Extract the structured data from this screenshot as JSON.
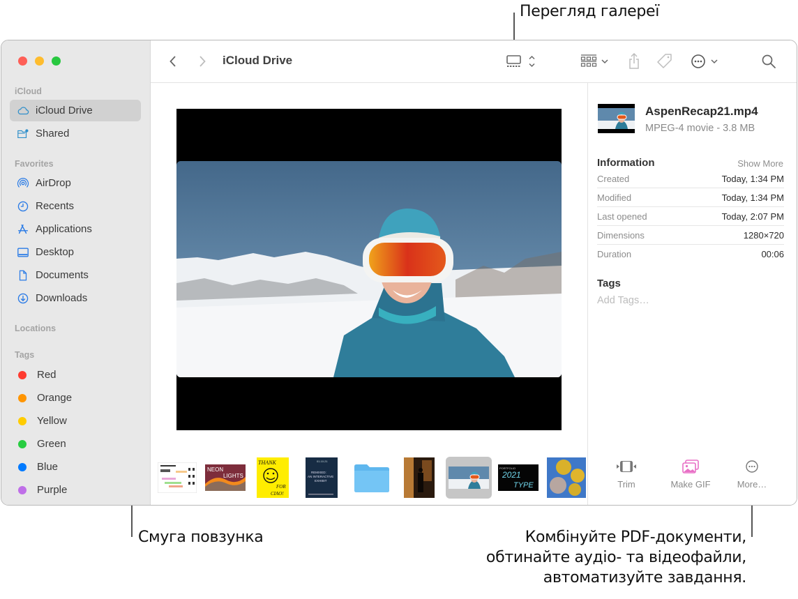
{
  "callouts": {
    "gallery_view": "Перегляд галереї",
    "scrubber_bar": "Смуга повзунка",
    "quick_actions": [
      "Комбінуйте PDF-документи,",
      "обтинайте аудіо- та відеофайли,",
      "автоматизуйте завдання."
    ]
  },
  "window": {
    "toolbar": {
      "title": "iCloud Drive",
      "buttons": [
        "back",
        "forward",
        "gallery-view",
        "group-by",
        "share",
        "tag",
        "more-actions",
        "search"
      ]
    },
    "sidebar": {
      "sections": [
        {
          "label": "iCloud",
          "items": [
            {
              "label": "iCloud Drive",
              "icon": "cloud-icon",
              "selected": true
            },
            {
              "label": "Shared",
              "icon": "shared-folder-icon"
            }
          ]
        },
        {
          "label": "Favorites",
          "items": [
            {
              "label": "AirDrop",
              "icon": "airdrop-icon"
            },
            {
              "label": "Recents",
              "icon": "clock-icon"
            },
            {
              "label": "Applications",
              "icon": "applications-icon"
            },
            {
              "label": "Desktop",
              "icon": "desktop-icon"
            },
            {
              "label": "Documents",
              "icon": "document-icon"
            },
            {
              "label": "Downloads",
              "icon": "download-icon"
            }
          ]
        },
        {
          "label": "Locations",
          "items": []
        },
        {
          "label": "Tags",
          "items": [
            {
              "label": "Red",
              "color": "#fe3b30"
            },
            {
              "label": "Orange",
              "color": "#ff9500"
            },
            {
              "label": "Yellow",
              "color": "#ffcc00"
            },
            {
              "label": "Green",
              "color": "#28cd41"
            },
            {
              "label": "Blue",
              "color": "#007aff"
            },
            {
              "label": "Purple",
              "color": "#bf6fe8"
            }
          ]
        }
      ]
    },
    "scrubber": {
      "thumbnails": [
        {
          "name": "infographic-document"
        },
        {
          "name": "neon-lights-poster",
          "text": "NEON LIGHTS"
        },
        {
          "name": "thank-you-poster",
          "text": "THANK FOR CIAO!"
        },
        {
          "name": "remixed-exhibit-poster",
          "text": "REMIXED: AN INTERACTIVE EXHIBIT"
        },
        {
          "name": "folder"
        },
        {
          "name": "silhouette-photo"
        },
        {
          "name": "aspen-recap-video",
          "selected": true
        },
        {
          "name": "portfolio-2021-type",
          "text": "2021 TYPE"
        },
        {
          "name": "gold-balloons-photo"
        }
      ]
    },
    "inspector": {
      "file_name": "AspenRecap21.mp4",
      "file_kind": "MPEG-4 movie - 3.8 MB",
      "information_label": "Information",
      "show_more": "Show More",
      "rows": [
        {
          "label": "Created",
          "value": "Today, 1:34 PM"
        },
        {
          "label": "Modified",
          "value": "Today, 1:34 PM"
        },
        {
          "label": "Last opened",
          "value": "Today, 2:07 PM"
        },
        {
          "label": "Dimensions",
          "value": "1280×720"
        },
        {
          "label": "Duration",
          "value": "00:06"
        }
      ],
      "tags_label": "Tags",
      "add_tags_placeholder": "Add Tags…",
      "actions": [
        {
          "label": "Trim",
          "icon": "trim-icon"
        },
        {
          "label": "Make GIF",
          "icon": "make-gif-icon",
          "color": "#e86fc6"
        },
        {
          "label": "More…",
          "icon": "more-icon"
        }
      ]
    }
  }
}
